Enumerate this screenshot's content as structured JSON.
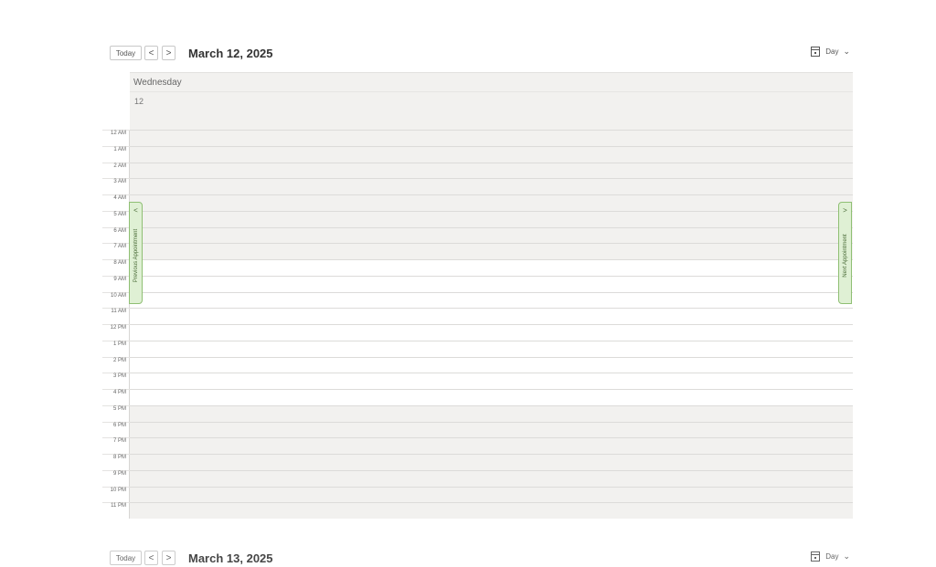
{
  "toolbar": {
    "today_label": "Today",
    "prev_label": "<",
    "next_label": ">",
    "date_title": "March 12, 2025",
    "view_label": "Day"
  },
  "day_header": {
    "weekday": "Wednesday",
    "day_number": "12"
  },
  "hours": [
    "12 AM",
    "1 AM",
    "2 AM",
    "3 AM",
    "4 AM",
    "5 AM",
    "6 AM",
    "7 AM",
    "8 AM",
    "9 AM",
    "10 AM",
    "11 AM",
    "12 PM",
    "1 PM",
    "2 PM",
    "3 PM",
    "4 PM",
    "5 PM",
    "6 PM",
    "7 PM",
    "8 PM",
    "9 PM",
    "10 PM",
    "11 PM"
  ],
  "work_hours": [
    "8 AM",
    "9 AM",
    "10 AM",
    "11 AM",
    "12 PM",
    "1 PM",
    "2 PM",
    "3 PM",
    "4 PM"
  ],
  "previous_appointment": {
    "arrow": "<",
    "label": "Previous Appointment"
  },
  "next_appointment": {
    "arrow": ">",
    "label": "Next Appointment"
  },
  "next_view": {
    "today_label": "Today",
    "prev_label": "<",
    "next_label": ">",
    "date_title": "March 13, 2025",
    "view_label": "Day"
  }
}
